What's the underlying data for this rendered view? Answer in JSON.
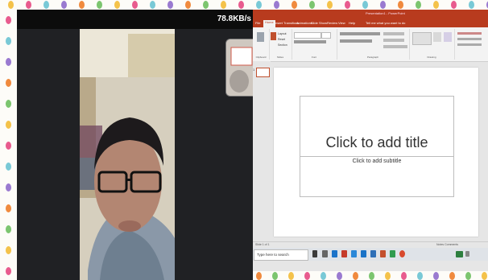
{
  "call": {
    "network_speed": "78.8KB/s"
  },
  "powerpoint": {
    "title_bar": "Presentation1 - PowerPoint",
    "tabs": [
      "File",
      "Home",
      "Insert",
      "Transitions",
      "Animations",
      "Slide Show",
      "Review",
      "View",
      "Help"
    ],
    "active_tab": "Home",
    "tell_me": "Tell me what you want to do",
    "ribbon_groups": [
      {
        "label": "Clipboard"
      },
      {
        "label": "Slides"
      },
      {
        "label": "Font"
      },
      {
        "label": "Paragraph"
      },
      {
        "label": "Drawing"
      }
    ],
    "ribbon_buttons": {
      "layout": "Layout",
      "reset": "Reset",
      "section": "Section"
    },
    "slide_number": "1",
    "placeholders": {
      "title": "Click to add title",
      "subtitle": "Click to add subtitle"
    },
    "status": {
      "left": "Slide 1 of 1",
      "right": "Notes    Comments"
    },
    "taskbar": {
      "search_placeholder": "Type here to search"
    }
  },
  "colors": {
    "ppt_accent": "#b83b1e",
    "call_background": "#202124"
  }
}
